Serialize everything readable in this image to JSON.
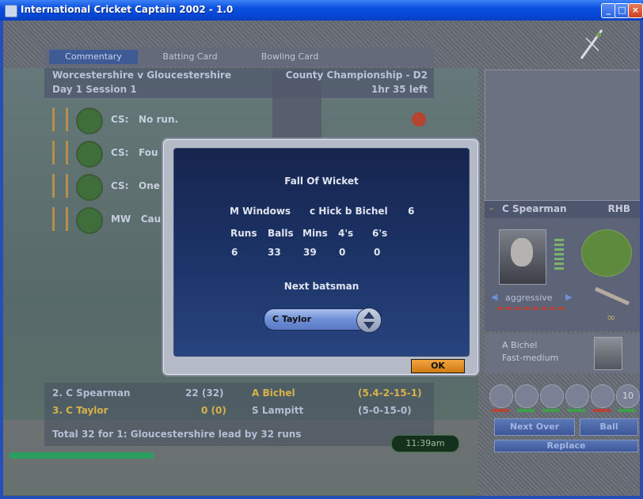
{
  "window": {
    "title": "International Cricket Captain 2002 - 1.0",
    "minimize": "_",
    "maximize": "□",
    "close": "×"
  },
  "tabs": [
    {
      "label": "Commentary",
      "active": true
    },
    {
      "label": "Batting Card",
      "active": false
    },
    {
      "label": "Bowling Card",
      "active": false
    }
  ],
  "match": {
    "fixture": "Worcestershire v Gloucestershire",
    "competition": "County Championship - D2",
    "session": "Day 1 Session 1",
    "time_left": "1hr 35 left"
  },
  "commentary": [
    {
      "speaker": "CS:",
      "text": "No run."
    },
    {
      "speaker": "CS:",
      "text": "Fou"
    },
    {
      "speaker": "CS:",
      "text": "One"
    },
    {
      "speaker": "MW",
      "text": "Cau"
    }
  ],
  "scoreboard": {
    "batsman1": {
      "label": "2. C Spearman",
      "score": "22 (32)"
    },
    "batsman2": {
      "label": "3. C Taylor",
      "score": "0 (0)"
    },
    "bowler1": {
      "name": "A Bichel",
      "figures": "(5.4-2-15-1)"
    },
    "bowler2": {
      "name": "S Lampitt",
      "figures": "(5-0-15-0)"
    },
    "total": "Total 32 for 1: Gloucestershire lead by 32 runs",
    "clock": "11:39am",
    "progress": 0.23
  },
  "player_panel": {
    "name": "C Spearman",
    "style": "RHB",
    "mode_left": "◀",
    "mode": "aggressive",
    "mode_right": "▶"
  },
  "bowler_panel": {
    "name": "A Bichel",
    "type": "Fast-medium"
  },
  "action_icons": [
    "",
    "",
    "",
    "",
    "",
    "10"
  ],
  "buttons": {
    "next_over": "Next Over",
    "ball": "Ball",
    "replace": "Replace"
  },
  "dialog": {
    "title": "Fall Of Wicket",
    "batsman": "M Windows",
    "dismissal": "c Hick b Bichel",
    "runs_total": "6",
    "headers": [
      "Runs",
      "Balls",
      "Mins",
      "4's",
      "6's"
    ],
    "values": [
      "6",
      "33",
      "39",
      "0",
      "0"
    ],
    "next_batsman_label": "Next batsman",
    "next_batsman_value": "C Taylor",
    "ok_label": "OK"
  }
}
